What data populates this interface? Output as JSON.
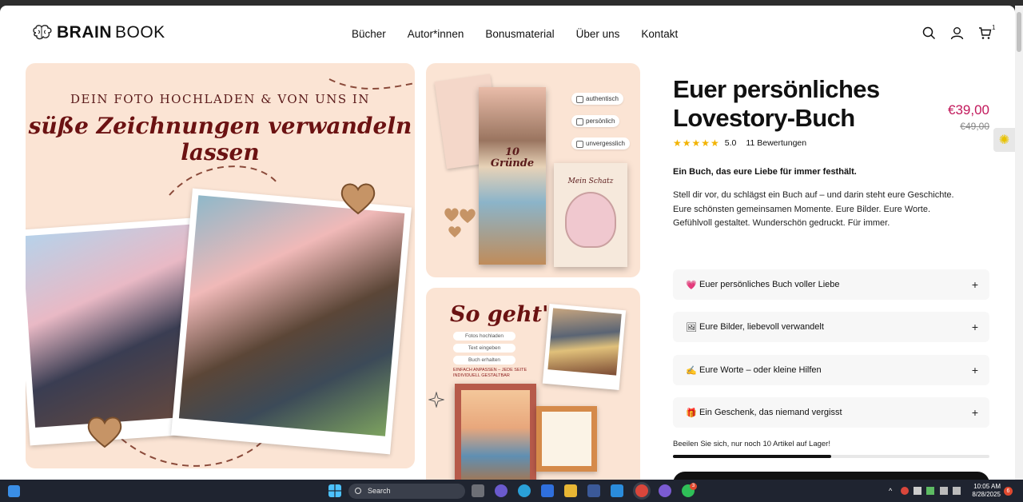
{
  "header": {
    "logo_bold": "BRAIN",
    "logo_thin": "BOOK",
    "nav": [
      "Bücher",
      "Autor*innen",
      "Bonusmaterial",
      "Über uns",
      "Kontakt"
    ],
    "cart_count": "1"
  },
  "gallery": {
    "main_line1": "DEIN FOTO HOCHLADEN & VON UNS IN",
    "main_line2": "süße Zeichnungen verwandeln lassen",
    "book_cover_num": "10",
    "book_cover_title": "Gründe",
    "book_page_title": "Mein Schatz",
    "tags": [
      "authentisch",
      "persönlich",
      "unvergesslich"
    ],
    "how_title": "So geht's",
    "steps": [
      "Fotos hochladen",
      "Text eingeben",
      "Buch erhalten"
    ],
    "small_note": "EINFACH ANPASSEN – JEDE SEITE INDIVIDUELL GESTALTBAR"
  },
  "product": {
    "title": "Euer persönliches Lovestory-Buch",
    "price": "€39,00",
    "old_price": "€49,00",
    "stars": "★★★★★",
    "rating": "5.0",
    "reviews": "11 Bewertungen",
    "lead": "Ein Buch, das eure Liebe für immer festhält.",
    "description": [
      "Stell dir vor, du schlägst ein Buch auf – und darin steht eure Geschichte.",
      "Eure schönsten gemeinsamen Momente. Eure Bilder. Eure Worte.",
      "Gefühlvoll gestaltet. Wunderschön gedruckt. Für immer."
    ],
    "accordion": [
      {
        "emoji": "💗",
        "label": "Euer persönliches Buch voller Liebe"
      },
      {
        "emoji": "🖼",
        "label": "Eure Bilder, liebevoll verwandelt"
      },
      {
        "emoji": "✍",
        "label": "Eure Worte – oder kleine Hilfen"
      },
      {
        "emoji": "🎁",
        "label": "Ein Geschenk, das niemand vergisst"
      }
    ],
    "stock_text": "Beeilen Sie sich, nur noch 10 Artikel auf Lager!",
    "stock_level": 0.5
  },
  "taskbar": {
    "search_placeholder": "Search",
    "time": "10:05 AM",
    "date": "8/28/2025",
    "notification_count": "6",
    "chrome_badge": "3"
  },
  "colors": {
    "accent_price": "#c2185b",
    "gallery_bg": "#fbe4d4",
    "heading_red": "#6b1212"
  }
}
